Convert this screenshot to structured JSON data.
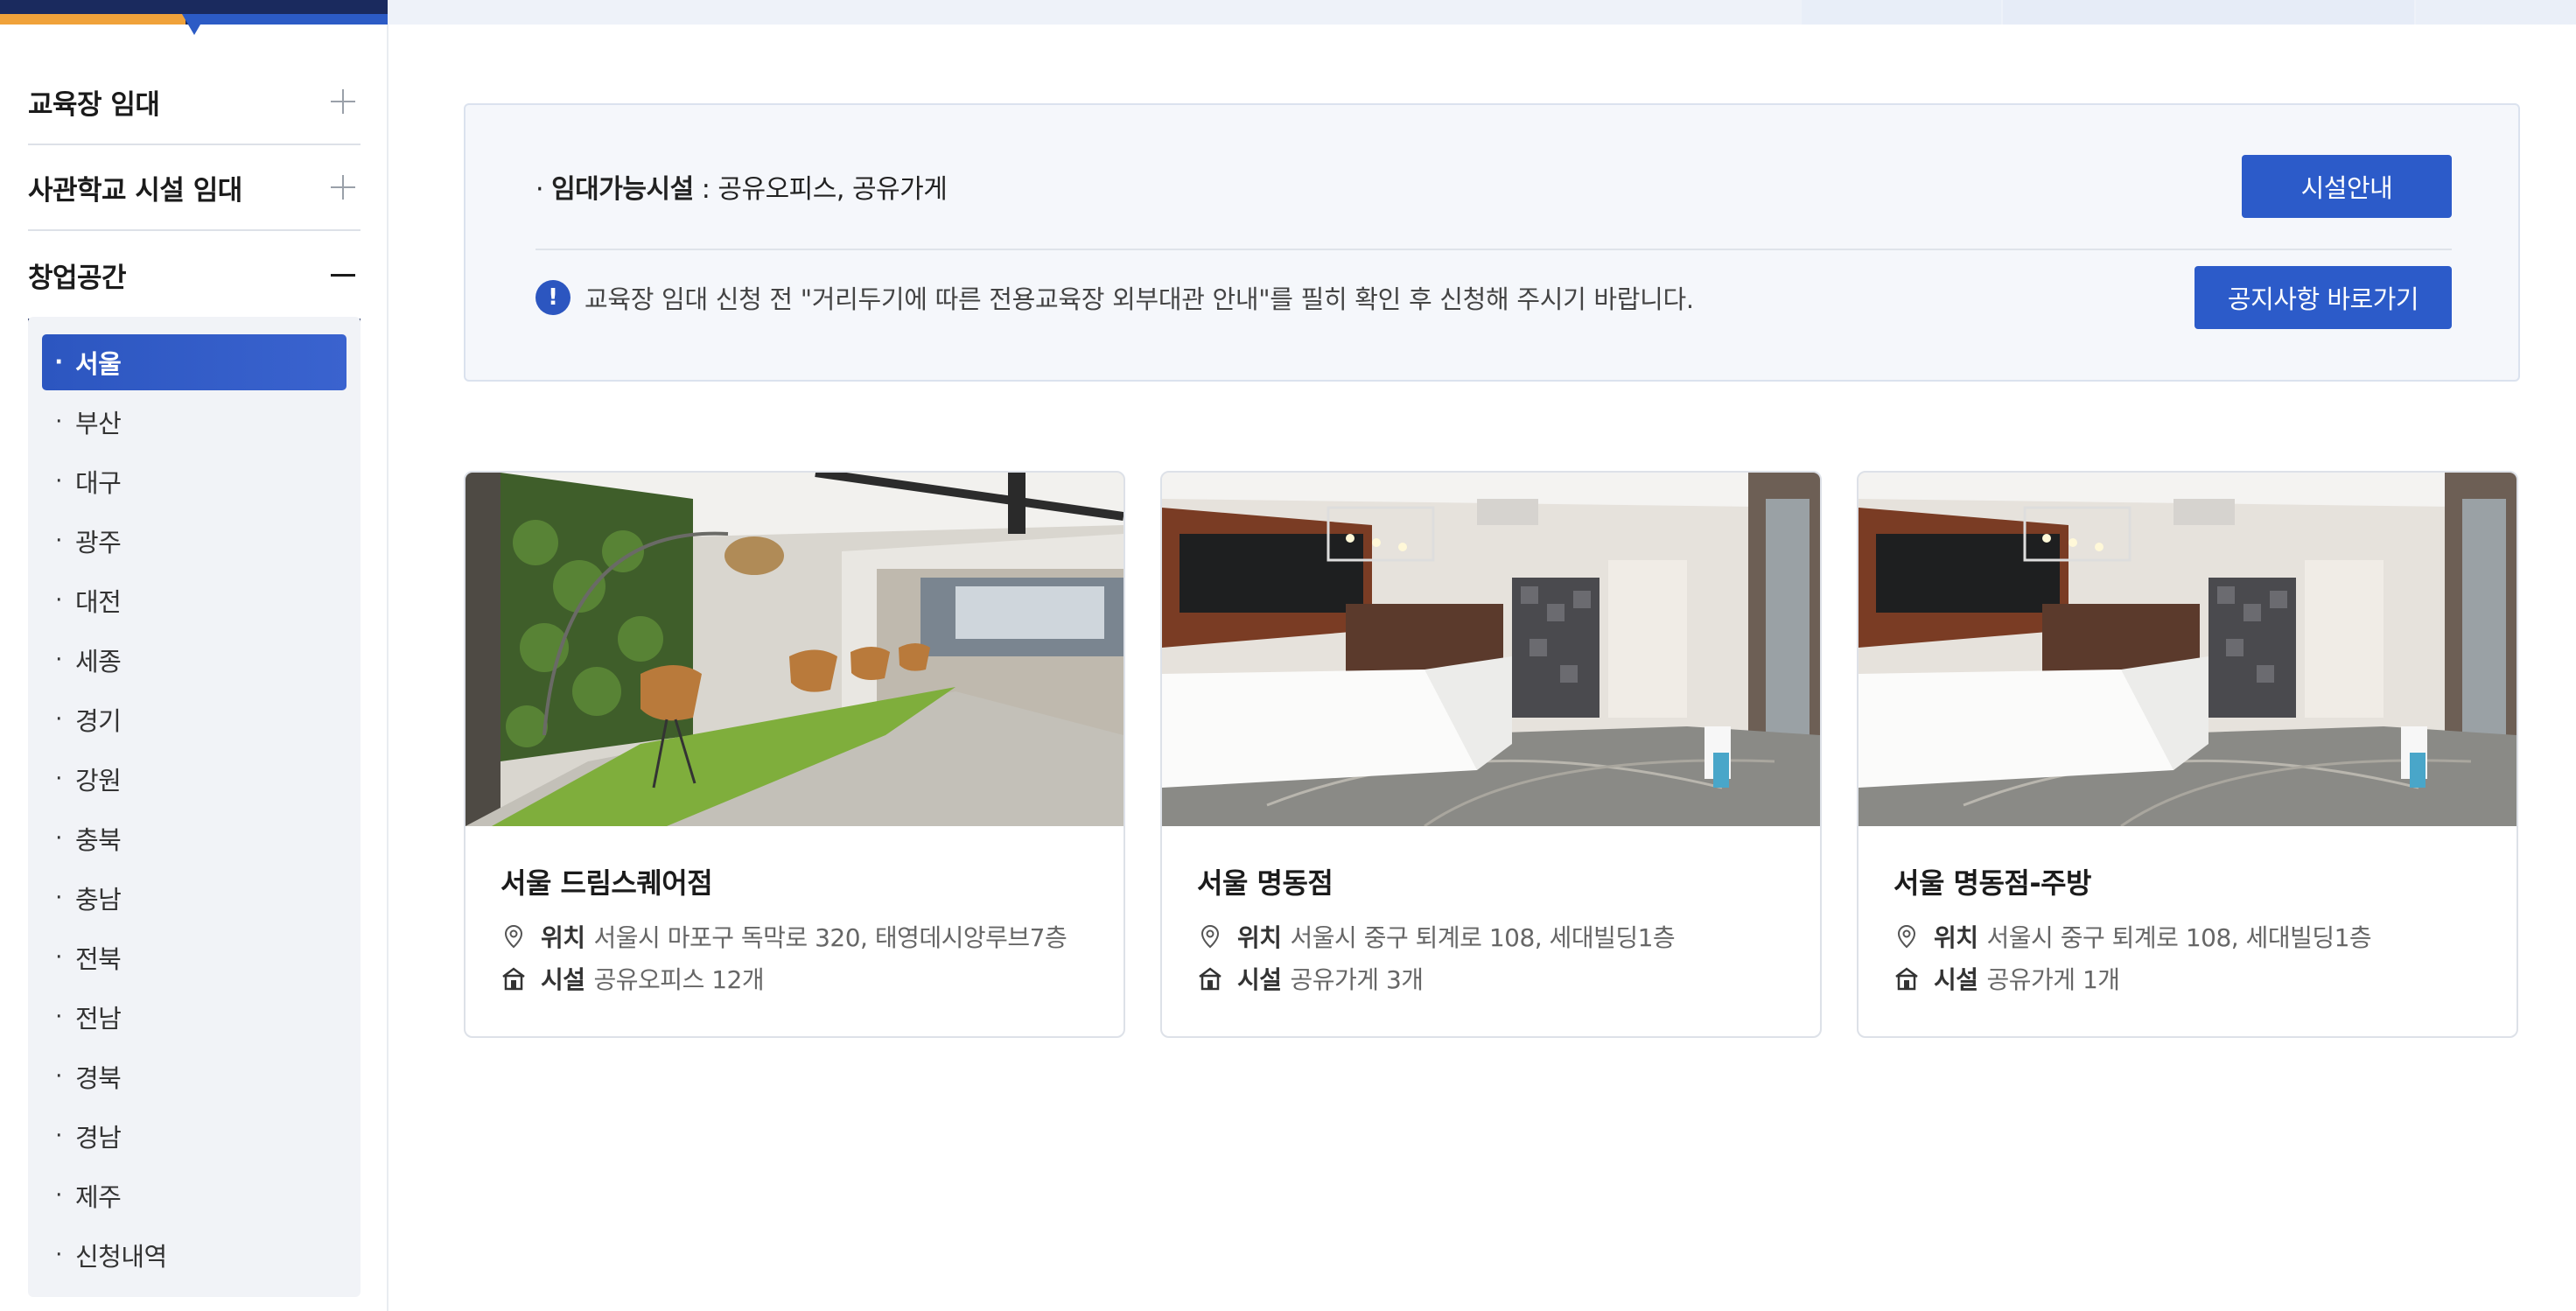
{
  "sidebar": {
    "accordion": [
      {
        "label": "교육장 임대",
        "state": "collapsed"
      },
      {
        "label": "사관학교 시설 임대",
        "state": "collapsed"
      },
      {
        "label": "창업공간",
        "state": "expanded"
      }
    ],
    "regions": [
      "서울",
      "부산",
      "대구",
      "광주",
      "대전",
      "세종",
      "경기",
      "강원",
      "충북",
      "충남",
      "전북",
      "전남",
      "경북",
      "경남",
      "제주",
      "신청내역"
    ],
    "selected": "서울"
  },
  "notice": {
    "available_label": "임대가능시설",
    "available_value": ": 공유오피스, 공유가게",
    "guide_button": "시설안내",
    "warning_icon": "!",
    "warning_text": "교육장 임대 신청 전 \"거리두기에 따른 전용교육장 외부대관 안내\"를 필히 확인 후 신청해 주시기 바랍니다.",
    "notice_button": "공지사항 바로가기"
  },
  "cards": [
    {
      "title": "서울 드림스퀘어점",
      "location_label": "위치",
      "location": "서울시 마포구 독막로 320, 태영데시앙루브7층",
      "facility_label": "시설",
      "facility": "공유오피스 12개",
      "photo": "lounge-with-green-wall"
    },
    {
      "title": "서울 명동점",
      "location_label": "위치",
      "location": "서울시 중구 퇴계로 108, 세대빌딩1층",
      "facility_label": "시설",
      "facility": "공유가게 3개",
      "photo": "shop-kitchen-counter"
    },
    {
      "title": "서울 명동점-주방",
      "location_label": "위치",
      "location": "서울시 중구 퇴계로 108, 세대빌딩1층",
      "facility_label": "시설",
      "facility": "공유가게 1개",
      "photo": "shop-kitchen-counter"
    }
  ],
  "colors": {
    "navy": "#1a2a5e",
    "accent_blue": "#2c5bc9",
    "orange": "#f0a23a",
    "panel_bg": "#f1f3f7"
  }
}
